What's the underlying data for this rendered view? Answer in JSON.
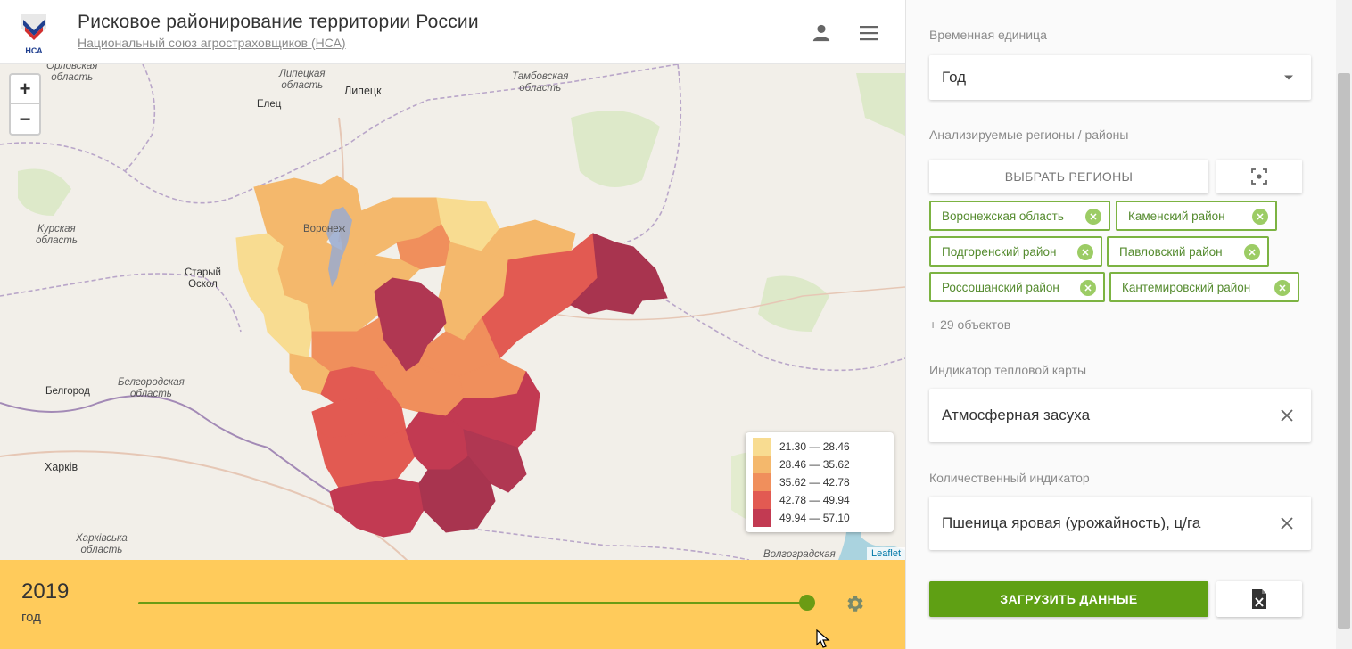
{
  "header": {
    "title": "Рисковое районирование территории России",
    "subtitle": "Национальный союз агростраховщиков (НСА)",
    "logo_text": "НСА"
  },
  "map": {
    "zoom_in": "+",
    "zoom_out": "−",
    "attribution": "Leaflet",
    "labels": {
      "orel": "Орловская\nобласть",
      "lipetsk_obl": "Липецкая\nобласть",
      "lipetsk": "Липецк",
      "tambov": "Тамбовская\nобласть",
      "elets": "Елец",
      "kursk": "Курская\nобласть",
      "voronezh": "Воронеж",
      "stary_oskol": "Старый\nОскол",
      "belgorod_obl": "Белгородская\nобласть",
      "belgorod": "Белгород",
      "kharkiv": "Харків",
      "kharkiv_obl": "Харківська\nобласть",
      "volgograd": "Волгоградская"
    },
    "legend": [
      {
        "label": "21.30 — 28.46",
        "color": "#f8dc91"
      },
      {
        "label": "28.46 — 35.62",
        "color": "#f4b86c"
      },
      {
        "label": "35.62 — 42.78",
        "color": "#f08f5c"
      },
      {
        "label": "42.78 — 49.94",
        "color": "#e25a52"
      },
      {
        "label": "49.94 — 57.10",
        "color": "#c23a52"
      }
    ]
  },
  "timeline": {
    "year": "2019",
    "unit": "год",
    "progress": 1.0
  },
  "panel": {
    "time_unit_label": "Временная единица",
    "time_unit_value": "Год",
    "regions_label": "Анализируемые регионы / районы",
    "select_regions_button": "ВЫБРАТЬ РЕГИОНЫ",
    "chips": [
      "Воронежская область",
      "Каменский район",
      "Подгоренский район",
      "Павловский район",
      "Россошанский район",
      "Кантемировский район"
    ],
    "more_objects": "+ 29 объектов",
    "heatmap_label": "Индикатор тепловой карты",
    "heatmap_value": "Атмосферная засуха",
    "quant_label": "Количественный индикатор",
    "quant_value": "Пшеница яровая (урожайность), ц/га",
    "load_button": "ЗАГРУЗИТЬ ДАННЫЕ"
  },
  "colors": {
    "accent_green": "#5fa014",
    "timeline_bg": "#ffcb5b",
    "chip_border": "#7cb342"
  }
}
